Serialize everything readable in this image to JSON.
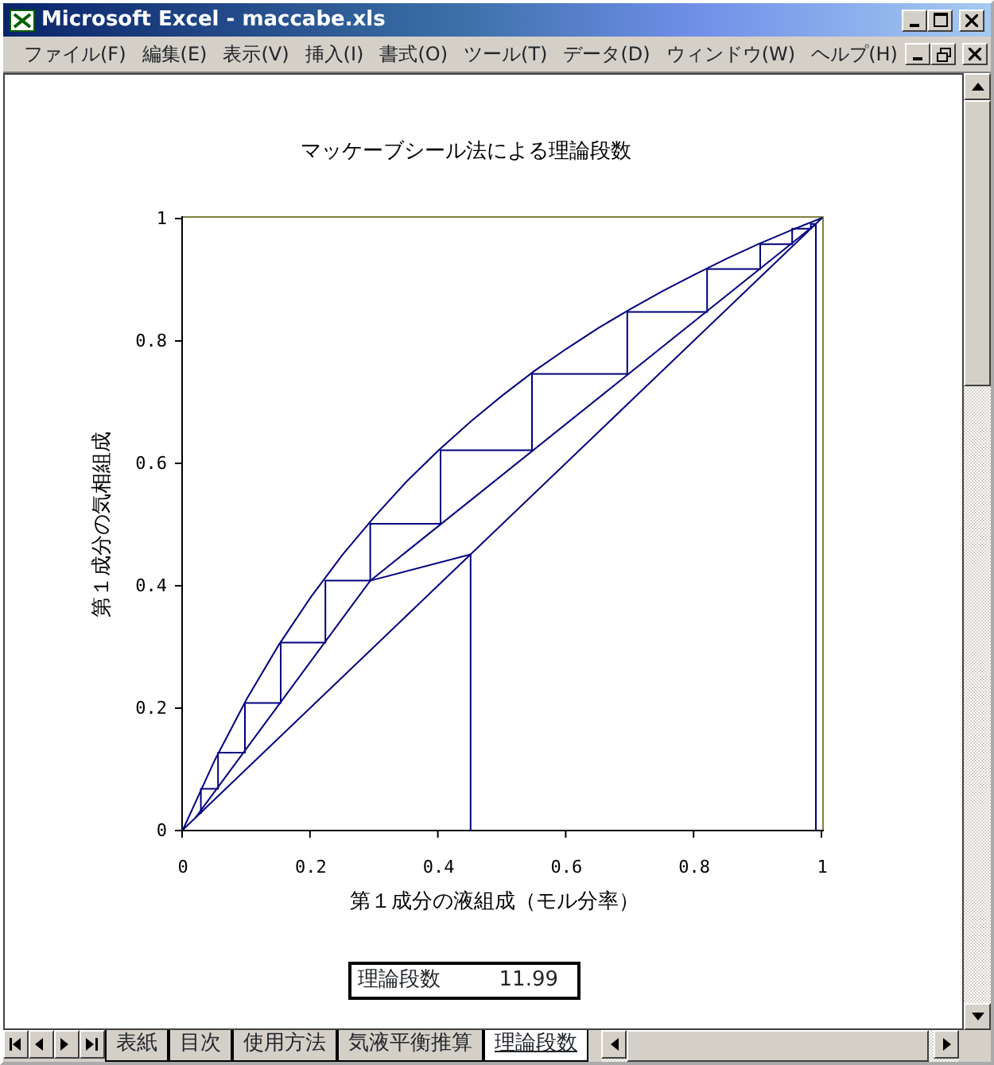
{
  "window": {
    "title": "Microsoft Excel - maccabe.xls"
  },
  "menu": [
    "ファイル(F)",
    "編集(E)",
    "表示(V)",
    "挿入(I)",
    "書式(O)",
    "ツール(T)",
    "データ(D)",
    "ウィンドウ(W)",
    "ヘルプ(H)"
  ],
  "chart": {
    "chart_data": {
      "type": "line",
      "title": "マッケーブシール法による理論段数",
      "xlabel": "第１成分の液組成（モル分率）",
      "ylabel": "第１成分の気相組成",
      "xlim": [
        0,
        1
      ],
      "ylim": [
        0,
        1
      ],
      "xticks": [
        {
          "value": 0,
          "label": "0"
        },
        {
          "value": 0.2,
          "label": "0.2"
        },
        {
          "value": 0.4,
          "label": "0.4"
        },
        {
          "value": 0.6,
          "label": "0.6"
        },
        {
          "value": 0.8,
          "label": "0.8"
        },
        {
          "value": 1,
          "label": "1"
        }
      ],
      "yticks": [
        {
          "value": 0,
          "label": "0"
        },
        {
          "value": 0.2,
          "label": "0.2"
        },
        {
          "value": 0.4,
          "label": "0.4"
        },
        {
          "value": 0.6,
          "label": "0.6"
        },
        {
          "value": 0.8,
          "label": "0.8"
        },
        {
          "value": 1,
          "label": "1"
        }
      ],
      "series": [
        {
          "x": [
            0,
            0.05,
            0.1,
            0.15,
            0.2,
            0.25,
            0.3,
            0.35,
            0.4,
            0.45,
            0.5,
            0.55,
            0.6,
            0.65,
            0.7,
            0.75,
            0.8,
            0.85,
            0.9,
            0.95,
            1
          ],
          "values": [
            0,
            0.114,
            0.214,
            0.302,
            0.38,
            0.45,
            0.512,
            0.569,
            0.62,
            0.667,
            0.71,
            0.75,
            0.786,
            0.82,
            0.851,
            0.88,
            0.907,
            0.933,
            0.957,
            0.979,
            1
          ]
        },
        {
          "x": [
            0,
            1
          ],
          "values": [
            0,
            1
          ]
        },
        {
          "x": [
            0.02,
            0.293,
            0.99
          ],
          "values": [
            0.02,
            0.407,
            0.99
          ]
        },
        {
          "x": [
            0.45,
            0.45,
            0.293
          ],
          "values": [
            0,
            0.45,
            0.407
          ]
        },
        {
          "x": [
            0.99,
            0.99
          ],
          "values": [
            0,
            0.99
          ]
        },
        {
          "x": [
            0.028,
            0.028,
            0.055,
            0.055,
            0.097,
            0.097,
            0.153,
            0.153,
            0.223,
            0.223,
            0.293,
            0.293,
            0.403,
            0.403,
            0.546,
            0.546,
            0.695,
            0.695,
            0.82,
            0.82,
            0.903,
            0.903,
            0.953,
            0.953,
            0.982,
            0.982,
            0.99
          ],
          "values": [
            0.026,
            0.067,
            0.067,
            0.126,
            0.126,
            0.207,
            0.207,
            0.306,
            0.306,
            0.407,
            0.407,
            0.5,
            0.5,
            0.62,
            0.62,
            0.745,
            0.745,
            0.846,
            0.846,
            0.916,
            0.916,
            0.957,
            0.957,
            0.982,
            0.982,
            0.99,
            0.99
          ]
        }
      ]
    }
  },
  "result": {
    "label": "理論段数",
    "value": "11.99"
  },
  "sheet_tabs": [
    {
      "label": "表紙",
      "selected": false
    },
    {
      "label": "目次",
      "selected": false
    },
    {
      "label": "使用方法",
      "selected": false
    },
    {
      "label": "気液平衡推算",
      "selected": false
    },
    {
      "label": "理論段数",
      "selected": true
    }
  ]
}
